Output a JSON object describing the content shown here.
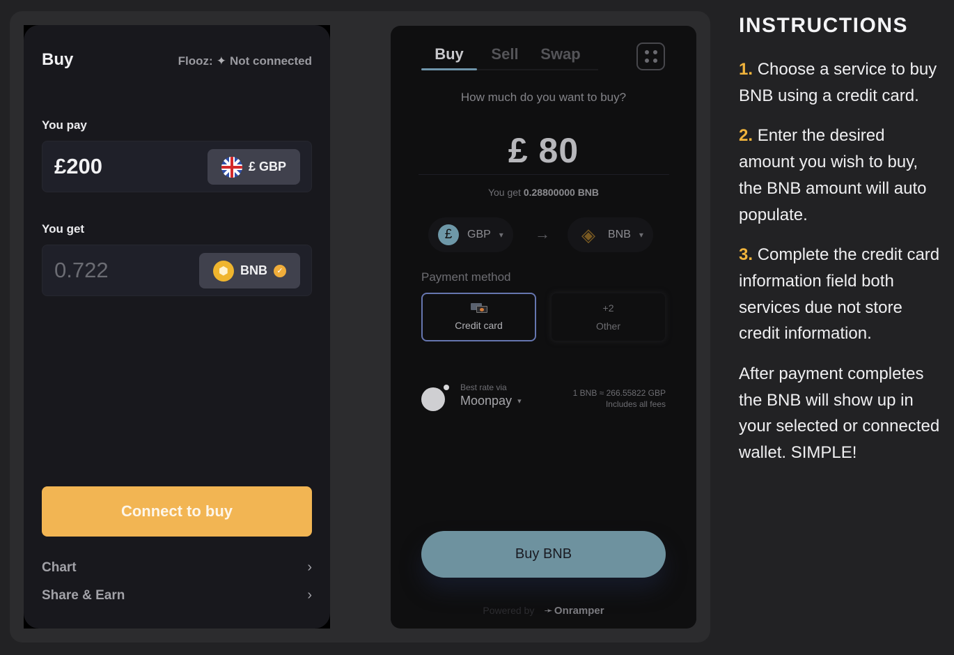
{
  "colors": {
    "accent_yellow": "#f2b553",
    "instruction_number": "#f1b43c",
    "buy_button": "#6e929f",
    "tab_indicator": "#6f95ab",
    "selected_payment_border": "#6676b0"
  },
  "widget": {
    "title": "Buy",
    "status_prefix": "Flooz:",
    "status_icon": "sparkle-icon",
    "status_text": "Not connected",
    "pay": {
      "label": "You pay",
      "amount": "£200",
      "currency_symbol": "£",
      "currency": "GBP",
      "currency_label": "£ GBP",
      "icon": "uk-flag-icon"
    },
    "get": {
      "label": "You get",
      "amount": "0.722",
      "token": "BNB",
      "icon": "bnb-coin-icon",
      "verified_icon": "verified-badge-icon"
    },
    "connect_button": "Connect to buy",
    "links": [
      {
        "label": "Chart",
        "icon": "chevron-right-icon"
      },
      {
        "label": "Share & Earn",
        "icon": "chevron-right-icon"
      }
    ]
  },
  "onramper": {
    "tabs": [
      {
        "label": "Buy",
        "active": true
      },
      {
        "label": "Sell",
        "active": false
      },
      {
        "label": "Swap",
        "active": false
      }
    ],
    "menu_icon": "grid-menu-icon",
    "question": "How much do you want to buy?",
    "amount_display": "£ 80",
    "you_get_prefix": "You get",
    "you_get_value": "0.28800000 BNB",
    "from_currency": {
      "label": "GBP",
      "symbol": "£"
    },
    "to_currency": {
      "label": "BNB"
    },
    "payment_method_label": "Payment method",
    "payment_methods": [
      {
        "label": "Credit card",
        "top": "",
        "selected": true
      },
      {
        "label": "Other",
        "top": "+2",
        "selected": false
      }
    ],
    "provider": {
      "best_rate_label": "Best rate via",
      "name": "Moonpay",
      "rate_line": "1 BNB ≈ 266.55822 GBP",
      "fees_line": "Includes all fees"
    },
    "buy_button": "Buy BNB",
    "powered_by": "Powered by",
    "brand": "Onramper"
  },
  "instructions": {
    "title": "INSTRUCTIONS",
    "steps": [
      {
        "num": "1.",
        "text": "Choose a service to buy BNB using a credit card."
      },
      {
        "num": "2.",
        "text": "Enter the desired amount you wish to buy, the BNB amount will auto populate."
      },
      {
        "num": "3.",
        "text": "Complete the credit card information field both services due not store credit information."
      }
    ],
    "closing": "After payment completes the BNB will show up in your selected or connected wallet. SIMPLE!"
  }
}
